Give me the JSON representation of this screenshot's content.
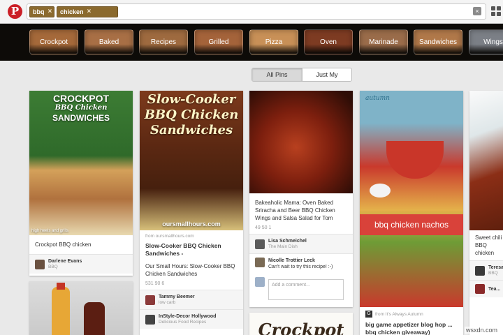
{
  "search": {
    "tokens": [
      "bbq",
      "chicken"
    ],
    "remove_glyph": "×",
    "clear_glyph": "×"
  },
  "categories": [
    "Crockpot",
    "Baked",
    "Recipes",
    "Grilled",
    "Pizza",
    "Oven",
    "Marinade",
    "Sandwiches",
    "Wings"
  ],
  "category_colors": [
    "#a5693a",
    "#a86f45",
    "#9e6a3f",
    "#a4633a",
    "#c89057",
    "#7d3b22",
    "#9a6c4a",
    "#b07849",
    "#7b7f86"
  ],
  "tabs": {
    "all": "All Pins",
    "mine": "Just My Pins"
  },
  "pins": {
    "crockpot": {
      "overlay_title": "CROCKPOT",
      "overlay_sub": "BBQ Chicken",
      "overlay_main": "SANDWICHES",
      "overlay_credit": "high heels and grills",
      "description": "Crockpot BBQ chicken",
      "user": "Darlene Evans",
      "board": "BBQ"
    },
    "slowcooker": {
      "overlay_title": "Slow-Cooker BBQ Chicken Sandwiches",
      "overlay_url": "oursmallhours.com",
      "from": "from oursmallhours.com",
      "title": "Slow-Cooker BBQ Chicken Sandwiches -",
      "description": "Our Small Hours: Slow-Cooker BBQ Chicken Sandwiches",
      "stats": "531  90  6",
      "user": "Tammy Beemer",
      "board": "low carb",
      "user2": "InStyle-Decor Hollywood",
      "board2": "Delicious Food Recipes"
    },
    "wings": {
      "description": "Bakeaholic Mama: Oven Baked Sriracha and Beer BBQ Chicken Wings and Salsa Salad for Tom",
      "stats": "49  50  1",
      "user": "Lisa Schmeichel",
      "board": "The Main Dish",
      "commenter": "Nicolle Trottier Leck",
      "comment": "Can't wait to try this recipe! :-)",
      "comment_placeholder": "Add a comment..."
    },
    "bottom_crockpot": {
      "text": "Crockpot"
    },
    "nachos": {
      "tag": "autumn",
      "banner": "bbq chicken nachos",
      "from": "from It's Always Autumn",
      "title": "big game appetizer blog hop ... bbq chicken giveaway)"
    },
    "right": {
      "description": "Sweet chili BBQ chicken",
      "user": "Teresa",
      "board": "BBQ",
      "user2": "Tea..."
    }
  },
  "watermark": "wsxdn.com"
}
